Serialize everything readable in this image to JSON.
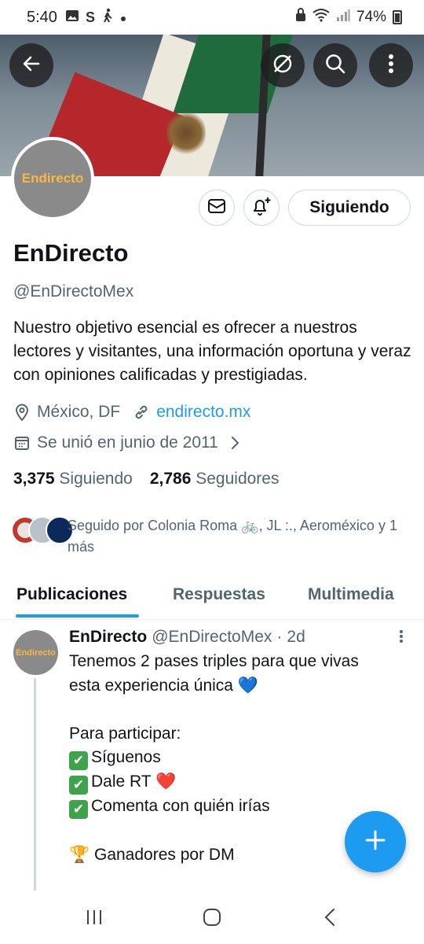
{
  "status_bar": {
    "time": "5:40",
    "battery": "74%",
    "s_label": "S"
  },
  "profile": {
    "avatar_text": "Endirecto",
    "name": "EnDirecto",
    "handle": "@EnDirectoMex",
    "bio": "Nuestro objetivo esencial es ofrecer a nuestros lectores y visitantes, una información oportuna y veraz con opiniones calificadas y prestigiadas.",
    "location": "México, DF",
    "website": "endirecto.mx",
    "joined": "Se unió en junio de 2011",
    "following_count": "3,375",
    "following_label": "Siguiendo",
    "followers_count": "2,786",
    "followers_label": "Seguidores",
    "followed_by": "Seguido por Colonia Roma 🚲, JL :., Aeroméxico y 1 más",
    "follow_button": "Siguiendo"
  },
  "tabs": [
    {
      "label": "Publicaciones",
      "active": true
    },
    {
      "label": "Respuestas",
      "active": false
    },
    {
      "label": "Multimedia",
      "active": false
    }
  ],
  "post": {
    "avatar_text": "Endirecto",
    "author": "EnDirecto",
    "handle": "@EnDirectoMex",
    "sep": "·",
    "time": "2d",
    "line1": "Tenemos 2 pases triples para que vivas",
    "line2": "esta experiencia única 💙",
    "line3": "",
    "line4": "Para participar:",
    "line5": "Síguenos",
    "line6": "Dale RT ❤️",
    "line7": "Comenta con quién irías",
    "line8": "",
    "line9": "🏆 Ganadores por DM"
  },
  "colors": {
    "accent": "#1d9bf0",
    "text": "#0f1419",
    "muted": "#536471",
    "check": "#3ea34a"
  },
  "icons": [
    "back-arrow-icon",
    "hide-icon",
    "search-icon",
    "more-vertical-icon",
    "mail-icon",
    "bell-plus-icon",
    "location-pin-icon",
    "link-icon",
    "calendar-icon",
    "chevron-right-icon",
    "plus-icon",
    "recents-icon",
    "home-icon",
    "back-icon"
  ]
}
